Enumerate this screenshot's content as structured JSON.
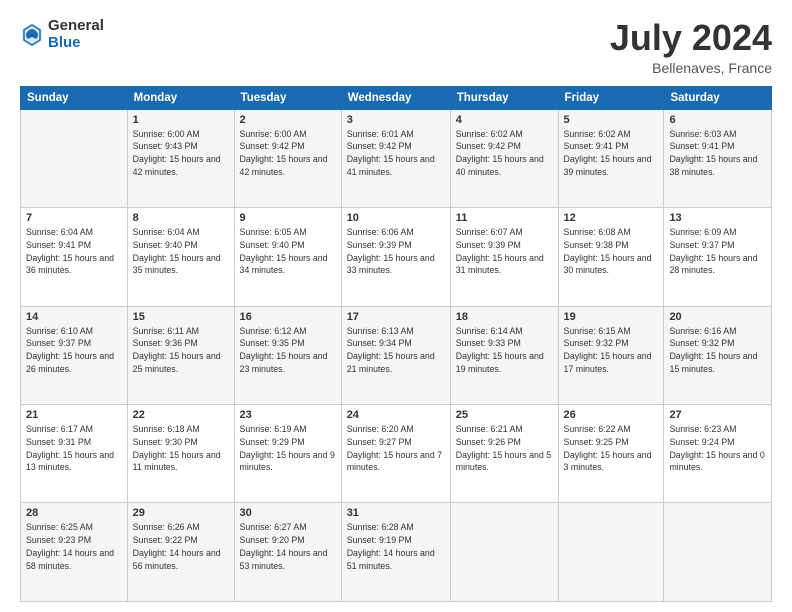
{
  "logo": {
    "general": "General",
    "blue": "Blue"
  },
  "title": "July 2024",
  "location": "Bellenaves, France",
  "weekdays": [
    "Sunday",
    "Monday",
    "Tuesday",
    "Wednesday",
    "Thursday",
    "Friday",
    "Saturday"
  ],
  "weeks": [
    [
      {
        "day": "",
        "info": ""
      },
      {
        "day": "1",
        "info": "Sunrise: 6:00 AM\nSunset: 9:43 PM\nDaylight: 15 hours\nand 42 minutes."
      },
      {
        "day": "2",
        "info": "Sunrise: 6:00 AM\nSunset: 9:42 PM\nDaylight: 15 hours\nand 42 minutes."
      },
      {
        "day": "3",
        "info": "Sunrise: 6:01 AM\nSunset: 9:42 PM\nDaylight: 15 hours\nand 41 minutes."
      },
      {
        "day": "4",
        "info": "Sunrise: 6:02 AM\nSunset: 9:42 PM\nDaylight: 15 hours\nand 40 minutes."
      },
      {
        "day": "5",
        "info": "Sunrise: 6:02 AM\nSunset: 9:41 PM\nDaylight: 15 hours\nand 39 minutes."
      },
      {
        "day": "6",
        "info": "Sunrise: 6:03 AM\nSunset: 9:41 PM\nDaylight: 15 hours\nand 38 minutes."
      }
    ],
    [
      {
        "day": "7",
        "info": "Sunrise: 6:04 AM\nSunset: 9:41 PM\nDaylight: 15 hours\nand 36 minutes."
      },
      {
        "day": "8",
        "info": "Sunrise: 6:04 AM\nSunset: 9:40 PM\nDaylight: 15 hours\nand 35 minutes."
      },
      {
        "day": "9",
        "info": "Sunrise: 6:05 AM\nSunset: 9:40 PM\nDaylight: 15 hours\nand 34 minutes."
      },
      {
        "day": "10",
        "info": "Sunrise: 6:06 AM\nSunset: 9:39 PM\nDaylight: 15 hours\nand 33 minutes."
      },
      {
        "day": "11",
        "info": "Sunrise: 6:07 AM\nSunset: 9:39 PM\nDaylight: 15 hours\nand 31 minutes."
      },
      {
        "day": "12",
        "info": "Sunrise: 6:08 AM\nSunset: 9:38 PM\nDaylight: 15 hours\nand 30 minutes."
      },
      {
        "day": "13",
        "info": "Sunrise: 6:09 AM\nSunset: 9:37 PM\nDaylight: 15 hours\nand 28 minutes."
      }
    ],
    [
      {
        "day": "14",
        "info": "Sunrise: 6:10 AM\nSunset: 9:37 PM\nDaylight: 15 hours\nand 26 minutes."
      },
      {
        "day": "15",
        "info": "Sunrise: 6:11 AM\nSunset: 9:36 PM\nDaylight: 15 hours\nand 25 minutes."
      },
      {
        "day": "16",
        "info": "Sunrise: 6:12 AM\nSunset: 9:35 PM\nDaylight: 15 hours\nand 23 minutes."
      },
      {
        "day": "17",
        "info": "Sunrise: 6:13 AM\nSunset: 9:34 PM\nDaylight: 15 hours\nand 21 minutes."
      },
      {
        "day": "18",
        "info": "Sunrise: 6:14 AM\nSunset: 9:33 PM\nDaylight: 15 hours\nand 19 minutes."
      },
      {
        "day": "19",
        "info": "Sunrise: 6:15 AM\nSunset: 9:32 PM\nDaylight: 15 hours\nand 17 minutes."
      },
      {
        "day": "20",
        "info": "Sunrise: 6:16 AM\nSunset: 9:32 PM\nDaylight: 15 hours\nand 15 minutes."
      }
    ],
    [
      {
        "day": "21",
        "info": "Sunrise: 6:17 AM\nSunset: 9:31 PM\nDaylight: 15 hours\nand 13 minutes."
      },
      {
        "day": "22",
        "info": "Sunrise: 6:18 AM\nSunset: 9:30 PM\nDaylight: 15 hours\nand 11 minutes."
      },
      {
        "day": "23",
        "info": "Sunrise: 6:19 AM\nSunset: 9:29 PM\nDaylight: 15 hours\nand 9 minutes."
      },
      {
        "day": "24",
        "info": "Sunrise: 6:20 AM\nSunset: 9:27 PM\nDaylight: 15 hours\nand 7 minutes."
      },
      {
        "day": "25",
        "info": "Sunrise: 6:21 AM\nSunset: 9:26 PM\nDaylight: 15 hours\nand 5 minutes."
      },
      {
        "day": "26",
        "info": "Sunrise: 6:22 AM\nSunset: 9:25 PM\nDaylight: 15 hours\nand 3 minutes."
      },
      {
        "day": "27",
        "info": "Sunrise: 6:23 AM\nSunset: 9:24 PM\nDaylight: 15 hours\nand 0 minutes."
      }
    ],
    [
      {
        "day": "28",
        "info": "Sunrise: 6:25 AM\nSunset: 9:23 PM\nDaylight: 14 hours\nand 58 minutes."
      },
      {
        "day": "29",
        "info": "Sunrise: 6:26 AM\nSunset: 9:22 PM\nDaylight: 14 hours\nand 56 minutes."
      },
      {
        "day": "30",
        "info": "Sunrise: 6:27 AM\nSunset: 9:20 PM\nDaylight: 14 hours\nand 53 minutes."
      },
      {
        "day": "31",
        "info": "Sunrise: 6:28 AM\nSunset: 9:19 PM\nDaylight: 14 hours\nand 51 minutes."
      },
      {
        "day": "",
        "info": ""
      },
      {
        "day": "",
        "info": ""
      },
      {
        "day": "",
        "info": ""
      }
    ]
  ]
}
